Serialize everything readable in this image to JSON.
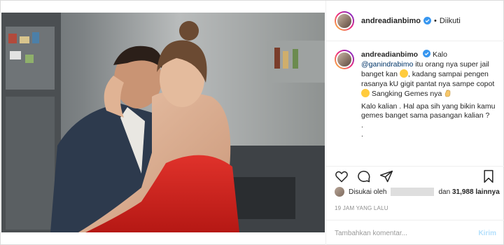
{
  "post": {
    "username": "andreadianbimo",
    "follow_label": "Diikuti",
    "separator": "•",
    "icons": [
      "verified-badge-icon",
      "heart-icon",
      "comment-icon",
      "share-icon",
      "bookmark-icon"
    ]
  },
  "caption": {
    "username": "andreadianbimo",
    "line1": " Kalo",
    "mention": "@ganindrabimo",
    "line2": " itu orang nya super jail banget kan",
    "line3": ", kadang sampai pengen rasanya kU gigit pantat nya sampe copot",
    "line4": " Sangking Gemes nya",
    "para2": "Kalo kalian . Hal apa sih yang bikin kamu gemes banget sama pasangan kalian ?",
    "dots1": ".",
    "dots2": "."
  },
  "likes": {
    "prefix": "Disukai oleh",
    "middle": "dan",
    "count": "31,988",
    "suffix": "lainnya"
  },
  "timestamp": "19 JAM YANG LALU",
  "comment_box": {
    "placeholder": "Tambahkan komentar...",
    "send_label": "Kirim"
  },
  "colors": {
    "verified": "#3897f0",
    "send_disabled": "#b2dffc",
    "dress": "#d8231f"
  }
}
